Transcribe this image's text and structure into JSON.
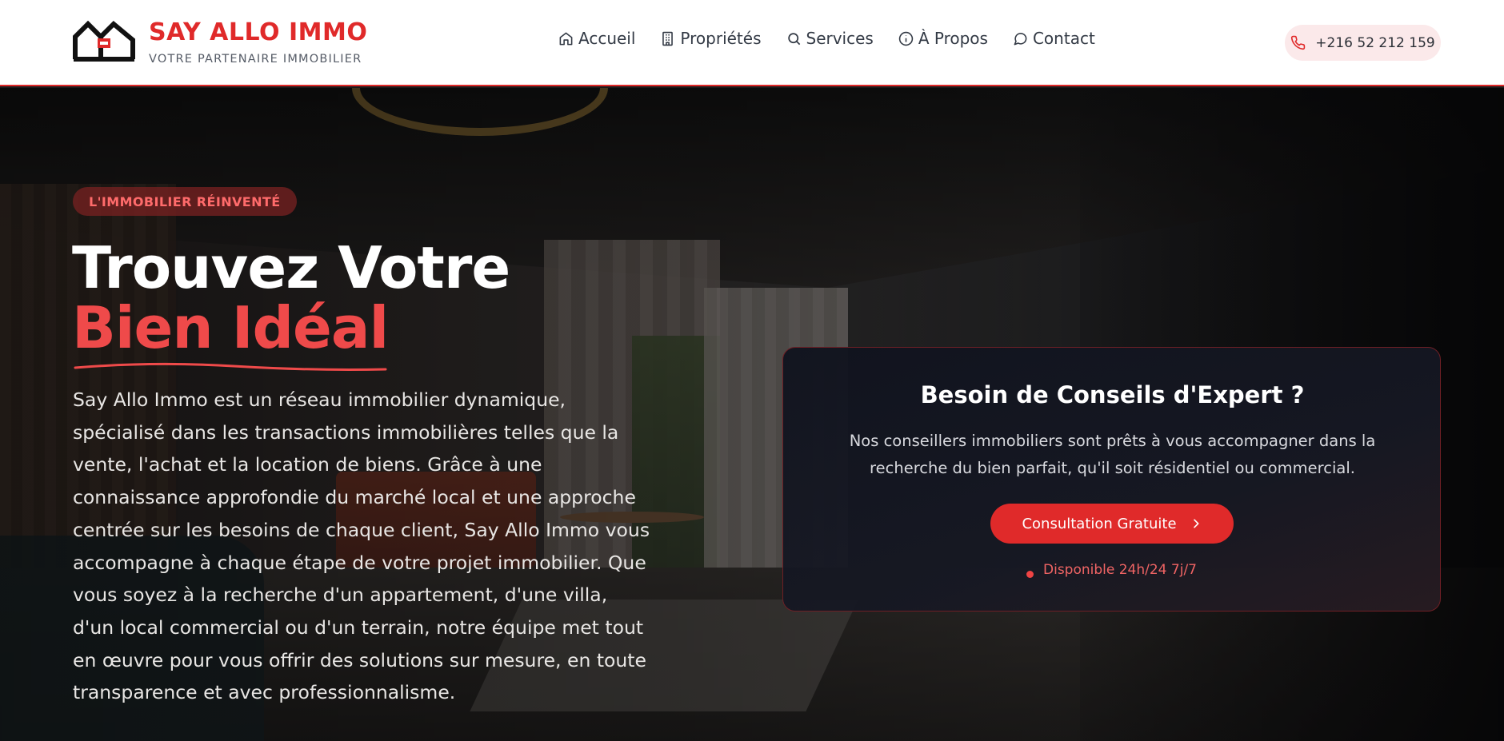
{
  "colors": {
    "accent": "#e02a2a",
    "accent_light": "#ef4a4a",
    "header_bg": "#ffffff",
    "card_bg": "#10131e",
    "badge_text": "#ff6b6b",
    "phone_pill_bg": "#fbe9ea"
  },
  "brand": {
    "title": "SAY ALLO IMMO",
    "tagline": "VOTRE PARTENAIRE IMMOBILIER",
    "logo_icon": "house-logo-icon"
  },
  "nav": {
    "items": [
      {
        "label": "Accueil",
        "icon": "home-icon"
      },
      {
        "label": "Propriétés",
        "icon": "building-icon"
      },
      {
        "label": "Services",
        "icon": "search-icon"
      },
      {
        "label": "À Propos",
        "icon": "info-icon"
      },
      {
        "label": "Contact",
        "icon": "chat-bubble-icon"
      }
    ]
  },
  "contact": {
    "phone": "+216 52 212 159",
    "icon": "phone-icon"
  },
  "hero": {
    "badge": "L'IMMOBILIER RÉINVENTÉ",
    "headline_line1": "Trouvez Votre",
    "headline_line2": "Bien Idéal",
    "description": "Say Allo Immo est un réseau immobilier dynamique, spécialisé dans les transactions immobilières telles que la vente, l'achat et la location de biens. Grâce à une connaissance approfondie du marché local et une approche centrée sur les besoins de chaque client, Say Allo Immo vous accompagne à chaque étape de votre projet immobilier. Que vous soyez à la recherche d'un appartement, d'une villa, d'un local commercial ou d'un terrain, notre équipe met tout en œuvre pour vous offrir des solutions sur mesure, en toute transparence et avec professionnalisme."
  },
  "expert_card": {
    "title": "Besoin de Conseils d'Expert ?",
    "text": "Nos conseillers immobiliers sont prêts à vous accompagner dans la recherche du bien parfait, qu'il soit résidentiel ou commercial.",
    "cta_label": "Consultation Gratuite",
    "cta_icon": "chevron-right-icon",
    "availability": "Disponible 24h/24 7j/7"
  }
}
